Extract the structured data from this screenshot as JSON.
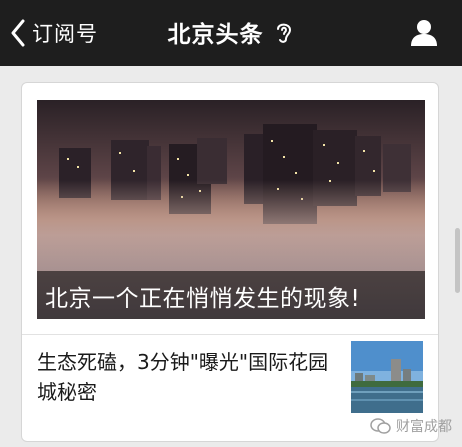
{
  "navbar": {
    "back_label": "订阅号",
    "title": "北京头条"
  },
  "feed": {
    "cover_article": {
      "title": "北京一个正在悄悄发生的现象!"
    },
    "articles": [
      {
        "title": "生态死磕，3分钟\"曝光\"国际花园城秘密"
      }
    ]
  },
  "watermarks": {
    "left": "",
    "right": "财富成都"
  },
  "colors": {
    "navbar": "#1e1e1e",
    "background": "#ebebeb",
    "card": "#ffffff"
  }
}
